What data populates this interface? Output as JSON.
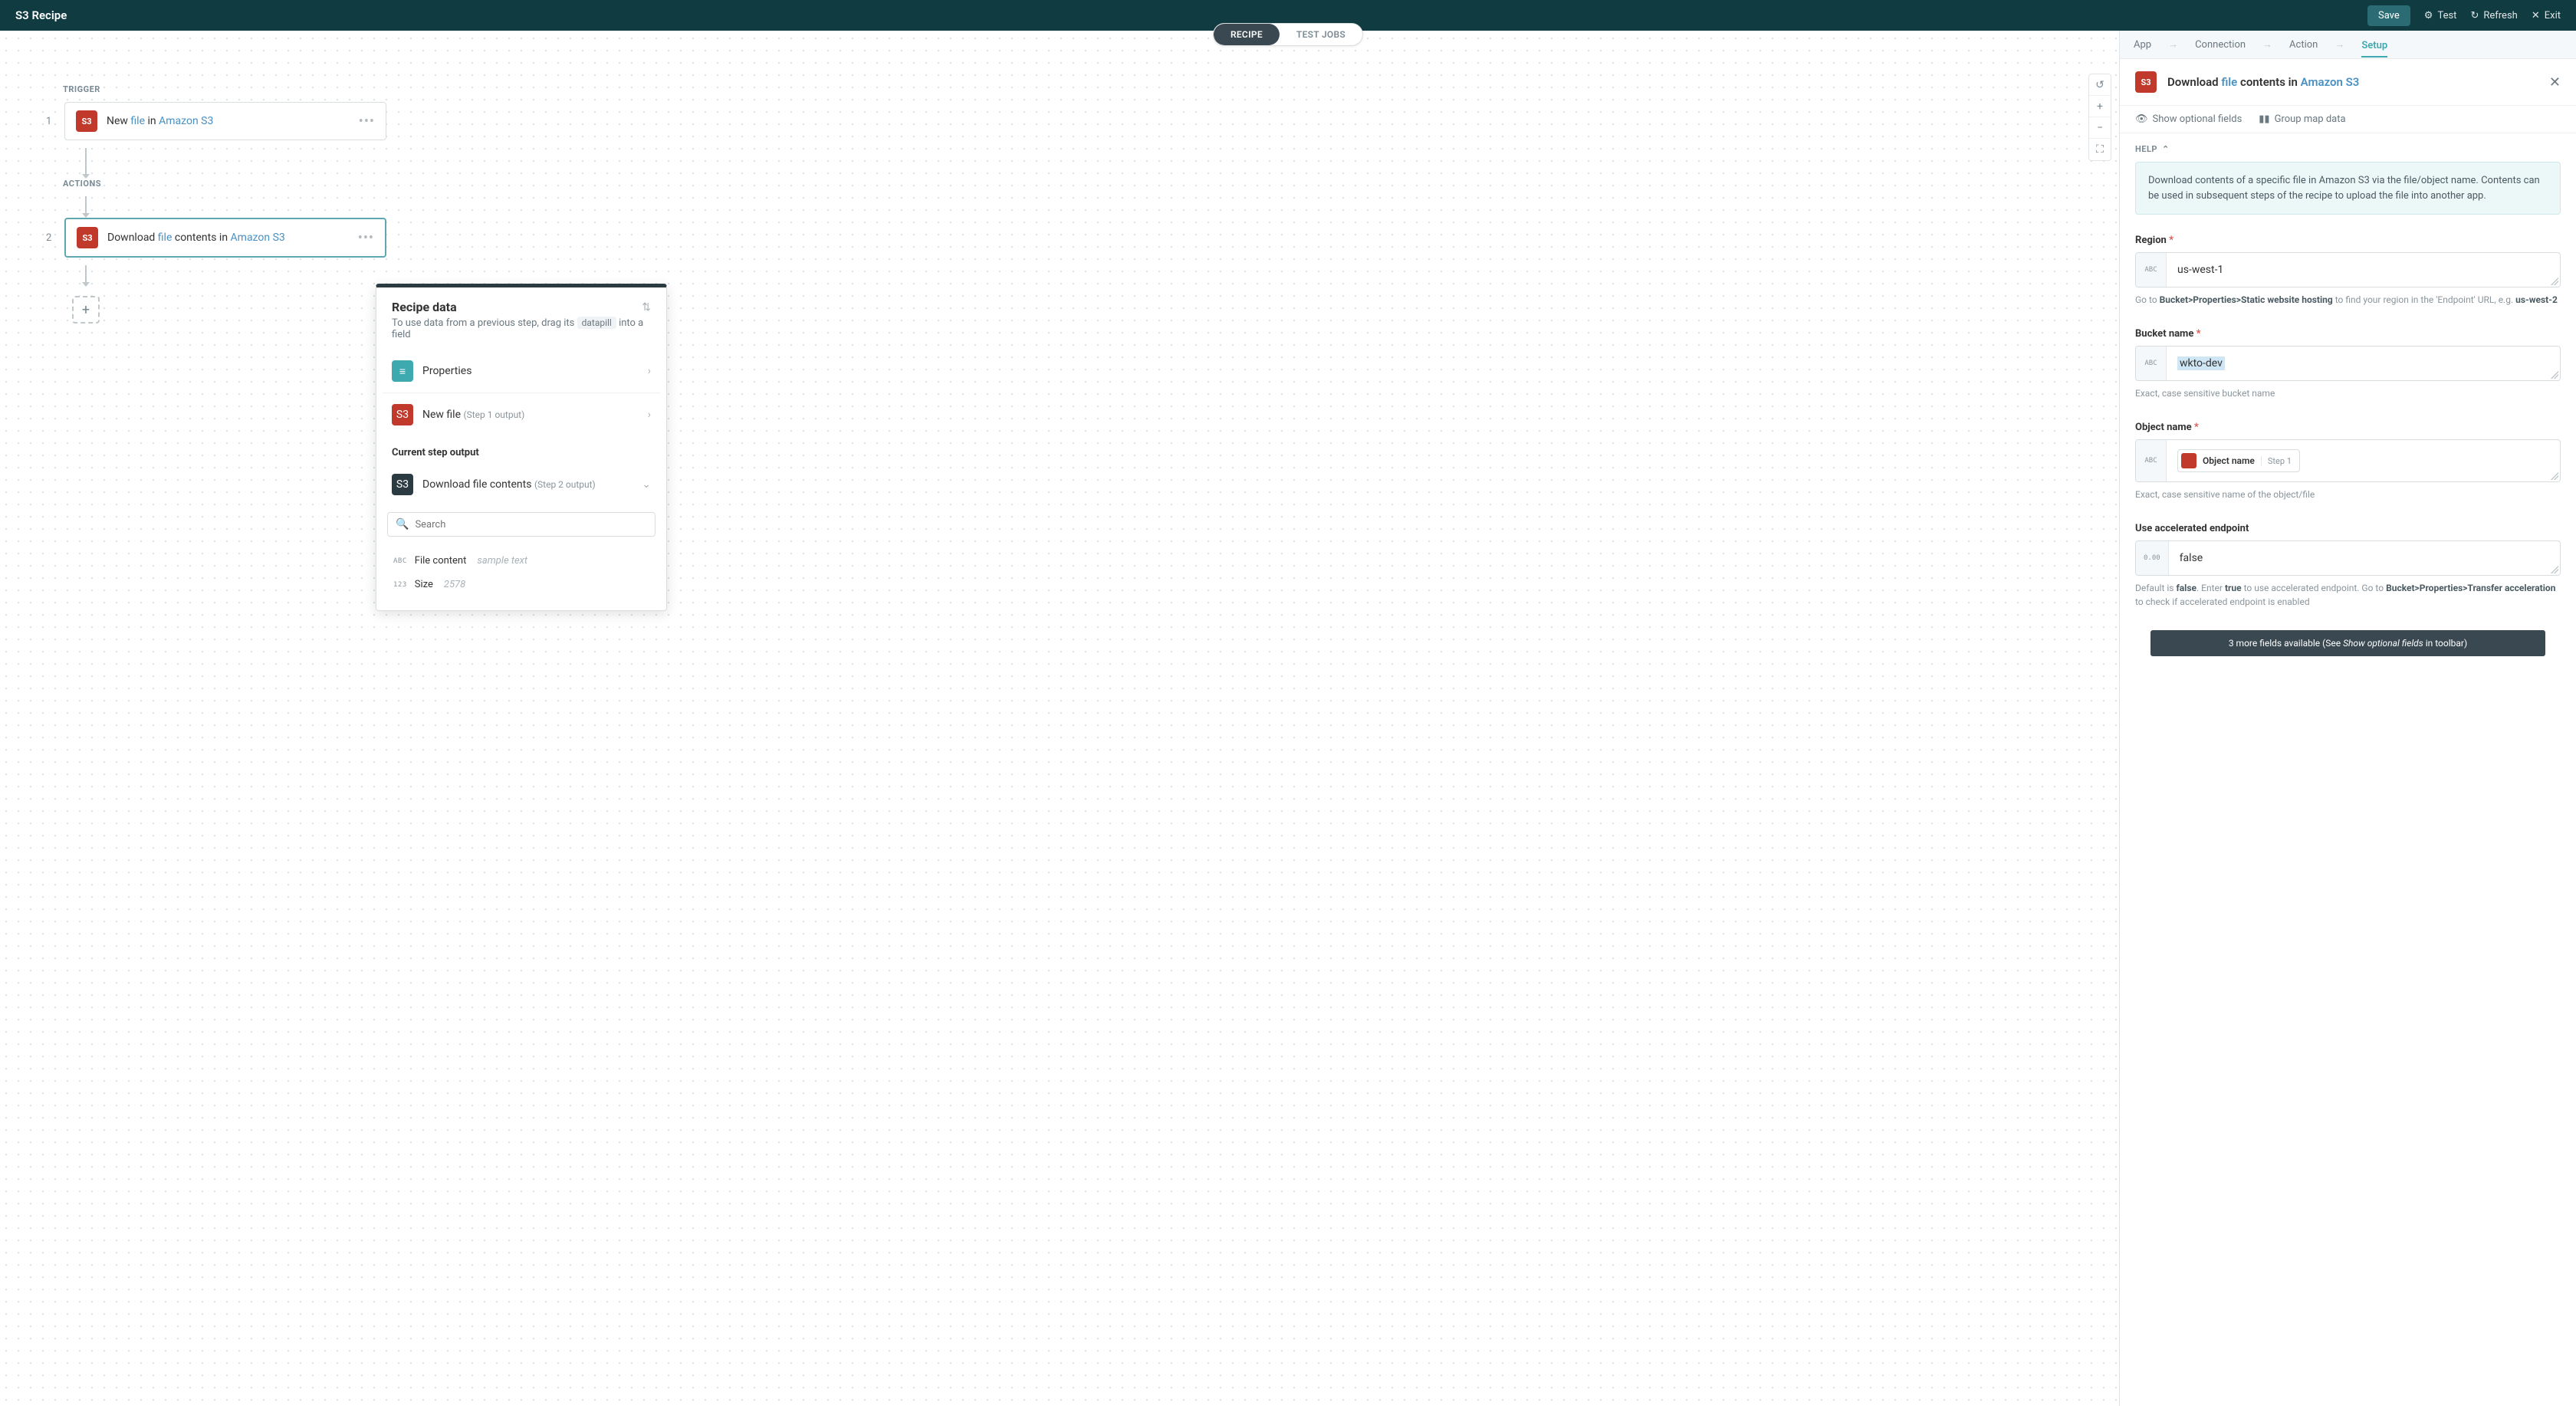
{
  "topbar": {
    "title": "S3 Recipe",
    "save": "Save",
    "test": "Test",
    "refresh": "Refresh",
    "exit": "Exit"
  },
  "tabs": {
    "recipe": "RECIPE",
    "testjobs": "TEST JOBS"
  },
  "flow": {
    "trigger_label": "TRIGGER",
    "actions_label": "ACTIONS",
    "step1_num": "1",
    "step1_prefix": "New ",
    "step1_link1": "file",
    "step1_mid": " in ",
    "step1_link2": "Amazon S3",
    "step2_num": "2",
    "step2_prefix": "Download ",
    "step2_link1": "file",
    "step2_mid": " contents in ",
    "step2_link2": "Amazon S3"
  },
  "zoom": {
    "undo": "↺",
    "plus": "+",
    "minus": "−",
    "fit": "⛶"
  },
  "recipe_data": {
    "title": "Recipe data",
    "sub_pre": "To use data from a previous step, drag its ",
    "sub_pill": "datapill",
    "sub_post": " into a field",
    "props": "Properties",
    "newfile": "New file",
    "newfile_meta": "(Step 1 output)",
    "section": "Current step output",
    "download": "Download file contents",
    "download_meta": "(Step 2 output)",
    "search_ph": "Search",
    "out1_type": "ABC",
    "out1_name": "File content",
    "out1_sample": "sample text",
    "out2_type": "123",
    "out2_name": "Size",
    "out2_sample": "2578"
  },
  "crumb": {
    "app": "App",
    "connection": "Connection",
    "action": "Action",
    "setup": "Setup"
  },
  "sp_header": {
    "pre": "Download ",
    "l1": "file",
    "mid": " contents in ",
    "l2": "Amazon S3"
  },
  "sp_toolbar": {
    "opt": "Show optional fields",
    "group": "Group map data"
  },
  "help": {
    "label": "HELP",
    "text": "Download contents of a specific file in Amazon S3 via the file/object name. Contents can be used in subsequent steps of the recipe to upload the file into another app."
  },
  "fields": {
    "region": {
      "label": "Region",
      "type": "ABC",
      "value": "us-west-1",
      "hint_pre": "Go to ",
      "hint_bold": "Bucket>Properties>Static website hosting",
      "hint_mid": " to find your region in the 'Endpoint' URL, e.g. ",
      "hint_bold2": "us-west-2"
    },
    "bucket": {
      "label": "Bucket name",
      "type": "ABC",
      "value": "wkto-dev",
      "hint": "Exact, case sensitive bucket name"
    },
    "object": {
      "label": "Object name",
      "type": "ABC",
      "pill_name": "Object name",
      "pill_meta": "Step 1",
      "hint": "Exact, case sensitive name of the object/file"
    },
    "accel": {
      "label": "Use accelerated endpoint",
      "type": "0.00",
      "value": "false",
      "hint_pre": "Default is ",
      "hint_b1": "false",
      "hint_mid1": ". Enter ",
      "hint_b2": "true",
      "hint_mid2": " to use accelerated endpoint. Go to ",
      "hint_b3": "Bucket>Properties>Transfer acceleration",
      "hint_post": " to check if accelerated endpoint is enabled"
    }
  },
  "footer": {
    "pre": "3 more fields available ",
    "mid_pre": "(See ",
    "italic": "Show optional fields",
    "post": " in toolbar)"
  }
}
